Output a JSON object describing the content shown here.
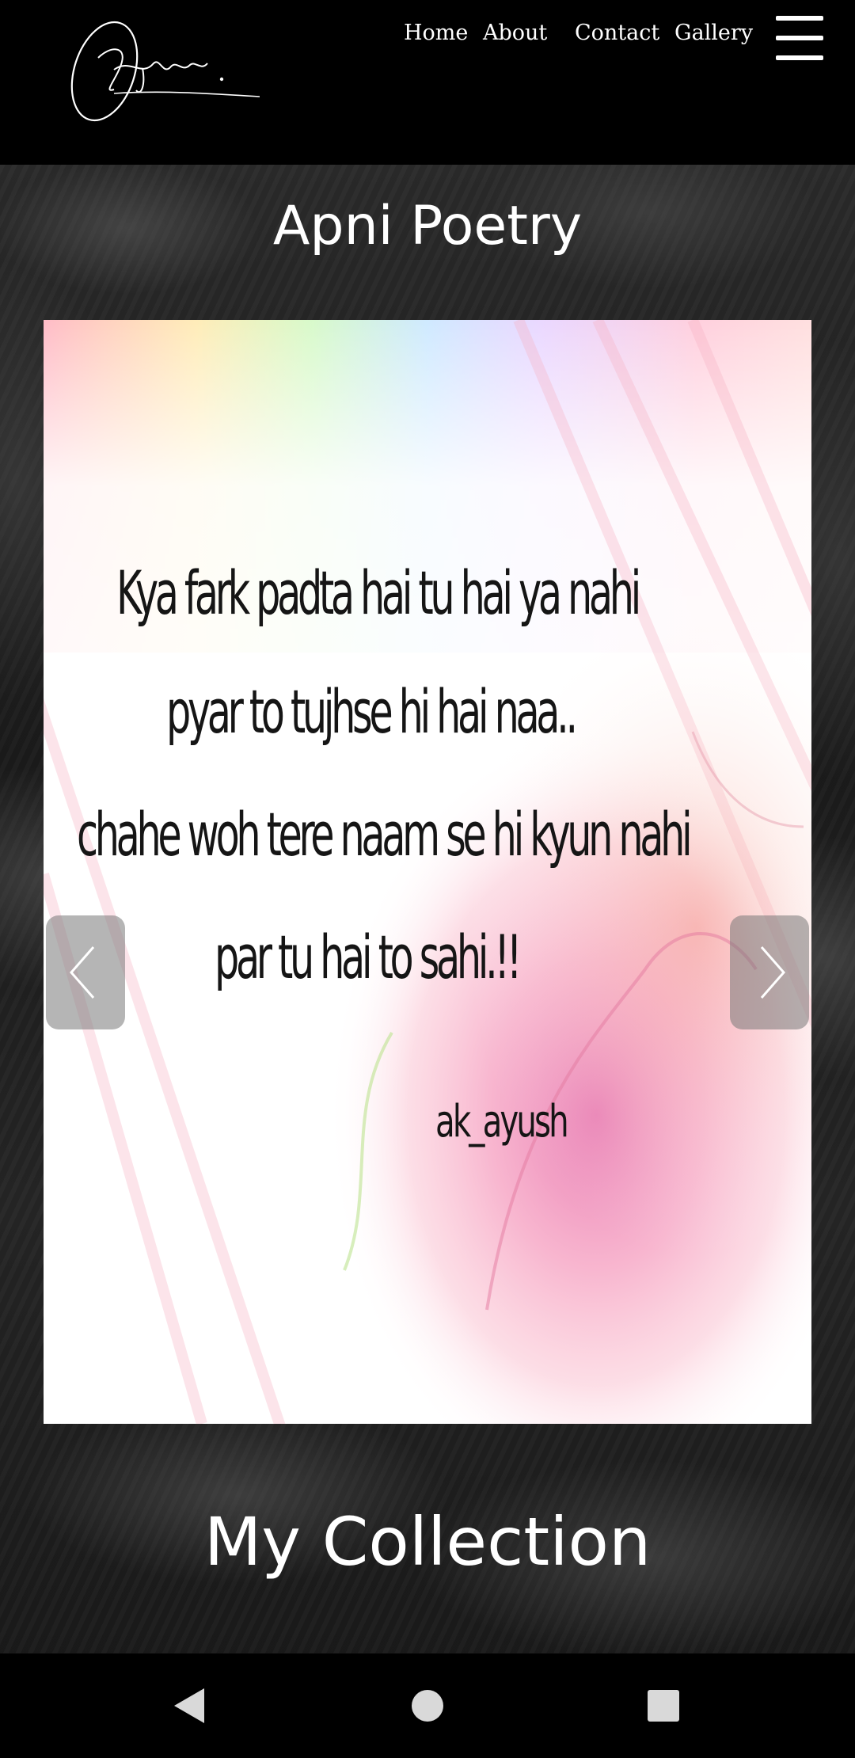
{
  "header": {
    "logo_text": "Ayush.",
    "nav": [
      "Home",
      "About",
      "Contact",
      "Gallery"
    ],
    "menu_icon": "hamburger-menu-icon"
  },
  "main": {
    "poetry_title": "Apni Poetry",
    "slide": {
      "lines": [
        "Kya fark padta hai tu hai ya nahi",
        "pyar to tujhse hi hai naa..",
        "chahe woh tere naam se hi kyun nahi",
        "par tu hai to sahi.!!"
      ],
      "signature": "ak_ayush"
    },
    "prev_icon": "chevron-left-icon",
    "next_icon": "chevron-right-icon",
    "collection_title": "My Collection"
  },
  "system_nav": {
    "back_icon": "back-triangle-icon",
    "home_icon": "home-circle-icon",
    "recents_icon": "recents-square-icon"
  },
  "colors": {
    "background": "#000000",
    "text": "#ffffff",
    "slide_background": "#ffffff",
    "arrow_overlay": "#787878"
  }
}
